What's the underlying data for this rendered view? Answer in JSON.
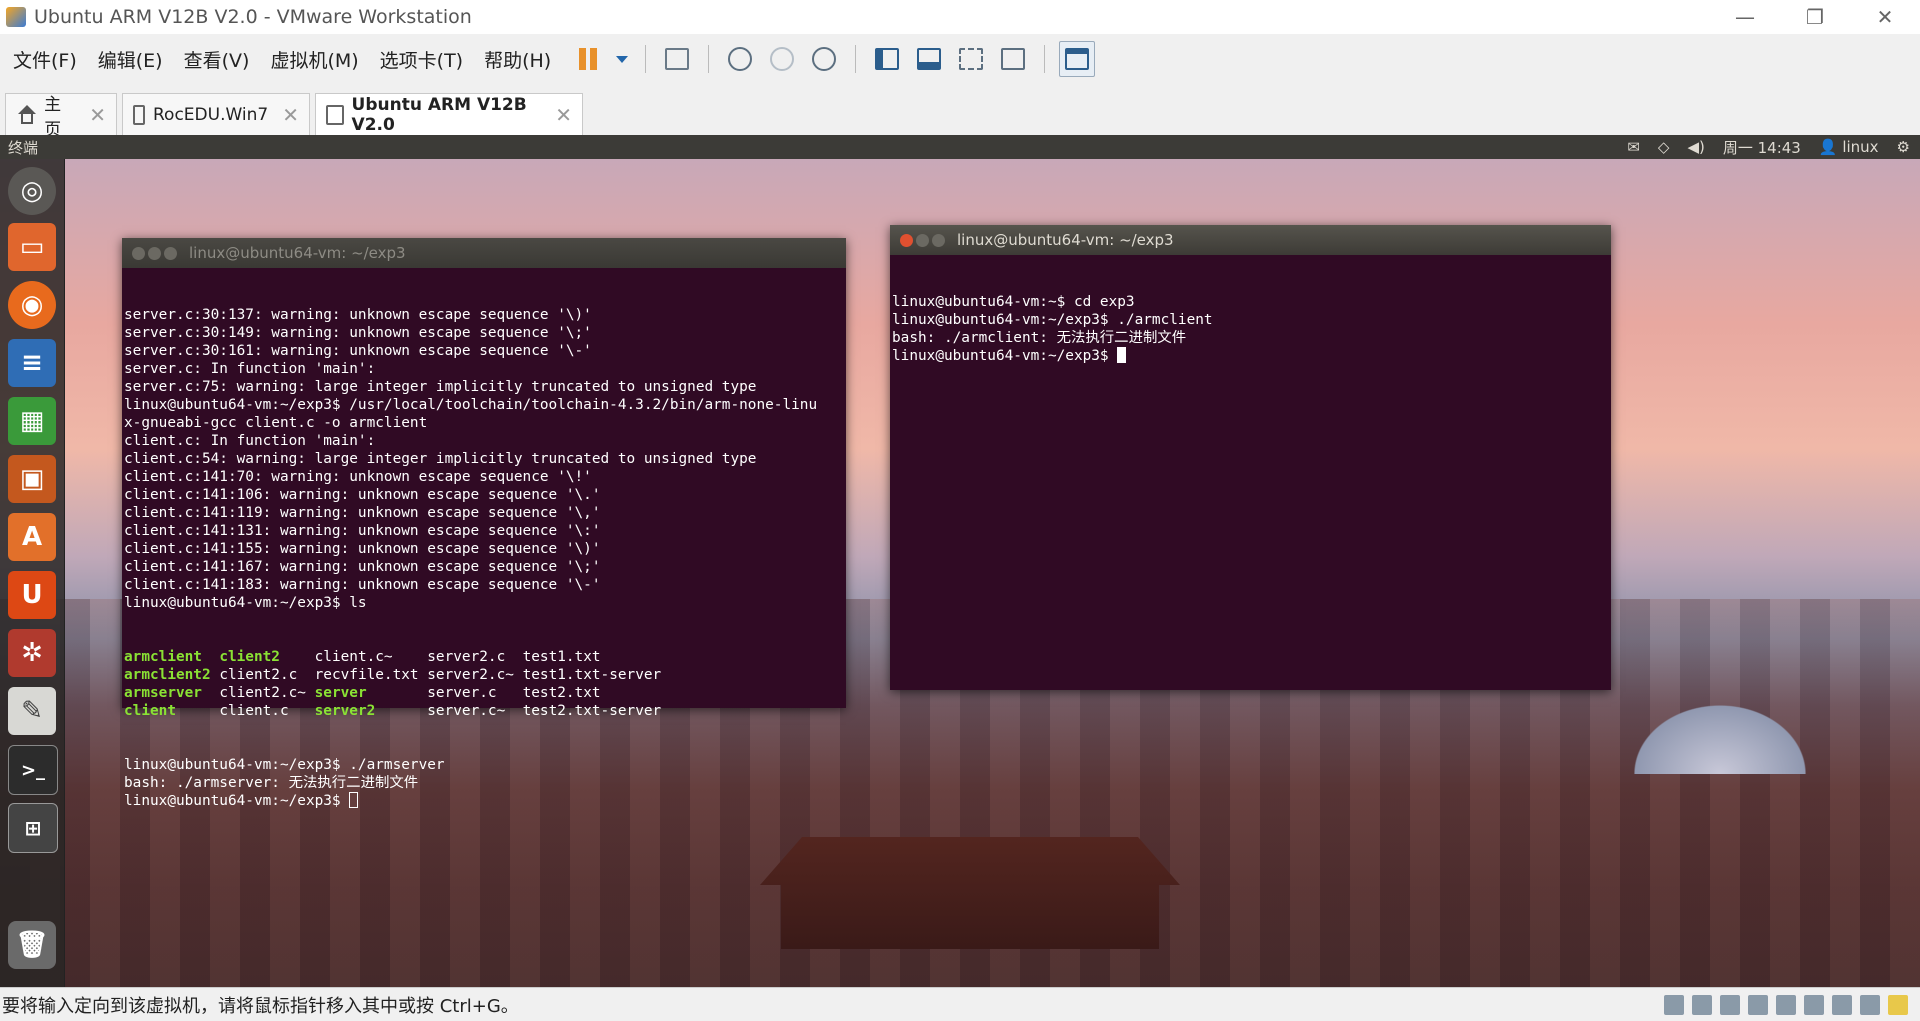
{
  "window": {
    "title": "Ubuntu ARM V12B V2.0 - VMware Workstation",
    "minimize": "—",
    "restore": "❐",
    "close": "✕"
  },
  "menu": {
    "items": [
      "文件(F)",
      "编辑(E)",
      "查看(V)",
      "虚拟机(M)",
      "选项卡(T)",
      "帮助(H)"
    ]
  },
  "tabs": [
    {
      "label": "主页"
    },
    {
      "label": "RocEDU.Win7"
    },
    {
      "label": "Ubuntu ARM V12B V2.0"
    }
  ],
  "guest_topbar": {
    "title": "终端",
    "clock": "周一 14:43",
    "user": "linux"
  },
  "terminal_left": {
    "title": "linux@ubuntu64-vm: ~/exp3",
    "lines": [
      "server.c:30:137: warning: unknown escape sequence '\\)'",
      "server.c:30:149: warning: unknown escape sequence '\\;'",
      "server.c:30:161: warning: unknown escape sequence '\\-'",
      "server.c: In function 'main':",
      "server.c:75: warning: large integer implicitly truncated to unsigned type",
      "linux@ubuntu64-vm:~/exp3$ /usr/local/toolchain/toolchain-4.3.2/bin/arm-none-linu",
      "x-gnueabi-gcc client.c -o armclient",
      "client.c: In function 'main':",
      "client.c:54: warning: large integer implicitly truncated to unsigned type",
      "client.c:141:70: warning: unknown escape sequence '\\!'",
      "client.c:141:106: warning: unknown escape sequence '\\.'",
      "client.c:141:119: warning: unknown escape sequence '\\,'",
      "client.c:141:131: warning: unknown escape sequence '\\:'",
      "client.c:141:155: warning: unknown escape sequence '\\)'",
      "client.c:141:167: warning: unknown escape sequence '\\;'",
      "client.c:141:183: warning: unknown escape sequence '\\-'",
      "linux@ubuntu64-vm:~/exp3$ ls"
    ],
    "ls_rows": [
      {
        "c1": "armclient",
        "c1g": true,
        "c2": "client2",
        "c2g": true,
        "c3": "client.c~",
        "c3g": false,
        "c4": "server2.c",
        "c4g": false,
        "c5": "test1.txt"
      },
      {
        "c1": "armclient2",
        "c1g": true,
        "c2": "client2.c",
        "c2g": false,
        "c3": "recvfile.txt",
        "c3g": false,
        "c4": "server2.c~",
        "c4g": false,
        "c5": "test1.txt-server"
      },
      {
        "c1": "armserver",
        "c1g": true,
        "c2": "client2.c~",
        "c2g": false,
        "c3": "server",
        "c3g": true,
        "c4": "server.c",
        "c4g": false,
        "c5": "test2.txt"
      },
      {
        "c1": "client",
        "c1g": true,
        "c2": "client.c",
        "c2g": false,
        "c3": "server2",
        "c3g": true,
        "c4": "server.c~",
        "c4g": false,
        "c5": "test2.txt-server"
      }
    ],
    "tail_lines": [
      "linux@ubuntu64-vm:~/exp3$ ./armserver",
      "bash: ./armserver: 无法执行二进制文件",
      "linux@ubuntu64-vm:~/exp3$ "
    ]
  },
  "terminal_right": {
    "title": "linux@ubuntu64-vm: ~/exp3",
    "lines": [
      "linux@ubuntu64-vm:~$ cd exp3",
      "linux@ubuntu64-vm:~/exp3$ ./armclient",
      "bash: ./armclient: 无法执行二进制文件",
      "linux@ubuntu64-vm:~/exp3$ "
    ]
  },
  "statusbar": {
    "message": "要将输入定向到该虚拟机，请将鼠标指针移入其中或按 Ctrl+G。"
  },
  "colors": {
    "terminal_bg": "#300a24",
    "ls_dir_green": "#8ae234",
    "pause_orange": "#e8912b"
  }
}
